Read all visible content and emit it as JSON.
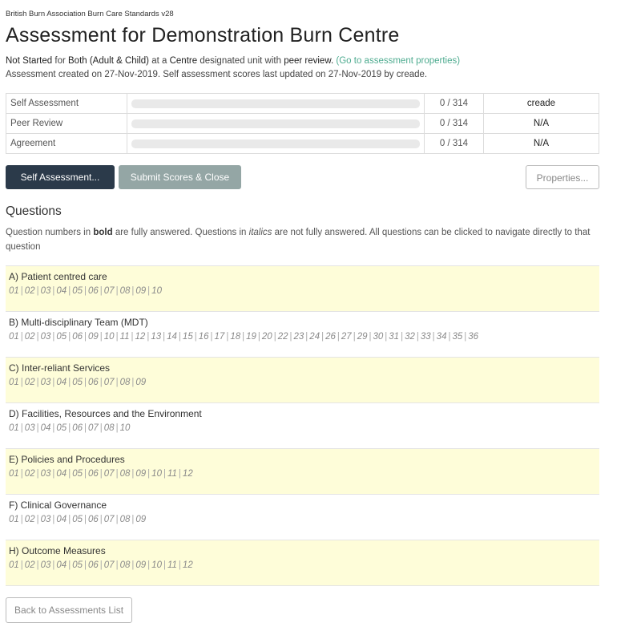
{
  "app_title": "British Burn Association Burn Care Standards v28",
  "page_title": "Assessment for Demonstration Burn Centre",
  "summary": {
    "status": "Not Started",
    "for_text": "for",
    "scope": "Both (Adult & Child)",
    "at_text": "at a",
    "unit_type": "Centre",
    "designated_text": "designated unit with",
    "review_type": "peer review.",
    "link_text": "(Go to assessment properties)",
    "created_line": "Assessment created on 27-Nov-2019. Self assessment scores last updated on 27-Nov-2019 by creade."
  },
  "progress": [
    {
      "label": "Self Assessment",
      "count": "0 / 314",
      "progress": 0,
      "by": "creade"
    },
    {
      "label": "Peer Review",
      "count": "0 / 314",
      "progress": 0,
      "by": "N/A"
    },
    {
      "label": "Agreement",
      "count": "0 / 314",
      "progress": 0,
      "by": "N/A"
    }
  ],
  "buttons": {
    "self_assessment": "Self Assessment...",
    "submit": "Submit Scores & Close",
    "properties": "Properties...",
    "back": "Back to Assessments List"
  },
  "questions_heading": "Questions",
  "help": {
    "part1": "Question numbers in",
    "bold_word": "bold",
    "part2": "are fully answered. Questions in",
    "italic_word": "italics",
    "part3": "are not fully answered. All questions can be clicked to navigate directly to that question"
  },
  "sections": [
    {
      "title": "A) Patient centred care",
      "questions": [
        "01",
        "02",
        "03",
        "04",
        "05",
        "06",
        "07",
        "08",
        "09",
        "10"
      ]
    },
    {
      "title": "B) Multi-disciplinary Team (MDT)",
      "questions": [
        "01",
        "02",
        "03",
        "05",
        "06",
        "09",
        "10",
        "11",
        "12",
        "13",
        "14",
        "15",
        "16",
        "17",
        "18",
        "19",
        "20",
        "22",
        "23",
        "24",
        "26",
        "27",
        "29",
        "30",
        "31",
        "32",
        "33",
        "34",
        "35",
        "36"
      ]
    },
    {
      "title": "C) Inter-reliant Services",
      "questions": [
        "01",
        "02",
        "03",
        "04",
        "05",
        "06",
        "07",
        "08",
        "09"
      ]
    },
    {
      "title": "D) Facilities, Resources and the Environment",
      "questions": [
        "01",
        "03",
        "04",
        "05",
        "06",
        "07",
        "08",
        "10"
      ]
    },
    {
      "title": "E) Policies and Procedures",
      "questions": [
        "01",
        "02",
        "03",
        "04",
        "05",
        "06",
        "07",
        "08",
        "09",
        "10",
        "11",
        "12"
      ]
    },
    {
      "title": "F) Clinical Governance",
      "questions": [
        "01",
        "02",
        "03",
        "04",
        "05",
        "06",
        "07",
        "08",
        "09"
      ]
    },
    {
      "title": "H) Outcome Measures",
      "questions": [
        "01",
        "02",
        "03",
        "04",
        "05",
        "06",
        "07",
        "08",
        "09",
        "10",
        "11",
        "12"
      ]
    }
  ]
}
